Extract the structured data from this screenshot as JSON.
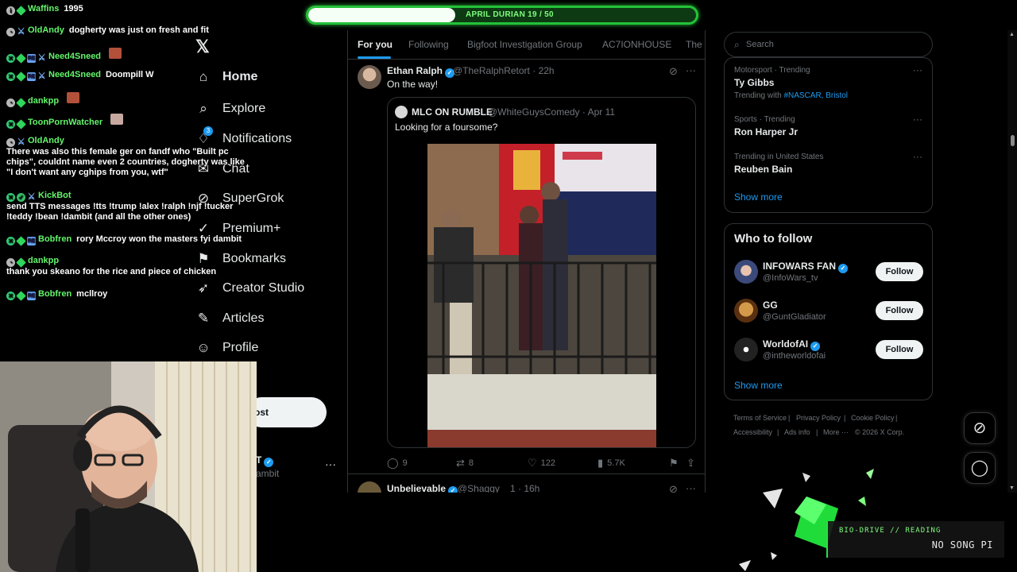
{
  "progress": {
    "label": "APRIL DURIAN 19 / 50",
    "current": 19,
    "total": 50
  },
  "chat": [
    {
      "user": "Waffins",
      "text": "1995"
    },
    {
      "user": "OldAndy",
      "text": "dogherty was just on fresh and fit"
    },
    {
      "user": "Need4Sneed",
      "text": ""
    },
    {
      "user": "Need4Sneed",
      "text": "Doompill W"
    },
    {
      "user": "dankpp",
      "text": ""
    },
    {
      "user": "ToonPornWatcher",
      "text": ""
    },
    {
      "user": "OldAndy",
      "text": "There was also this female ger on fandf who \"Built pc chips\", couldnt name even 2 countries, dogherty was like \"I don't want any cghips from you, wtf\""
    },
    {
      "user": "KickBot",
      "text": "send TTS messages !tts !trump !alex !ralph !njf !tucker !teddy !bean !dambit (and all the other ones)"
    },
    {
      "user": "Bobfren",
      "text": "rory Mccroy won the masters fyi dambit"
    },
    {
      "user": "dankpp",
      "text": "thank you skeano for the rice and piece of chicken"
    },
    {
      "user": "Bobfren",
      "text": "mcllroy"
    }
  ],
  "nav": {
    "logo": "𝕏",
    "items": [
      {
        "label": "Home",
        "icon": "home-icon",
        "glyph": "⌂"
      },
      {
        "label": "Explore",
        "icon": "search-icon",
        "glyph": "⌕"
      },
      {
        "label": "Notifications",
        "icon": "bell-icon",
        "glyph": "🔔"
      },
      {
        "label": "Chat",
        "icon": "chat-icon",
        "glyph": "✉"
      },
      {
        "label": "SuperGrok",
        "icon": "grok-icon",
        "glyph": "⊘"
      },
      {
        "label": "Premium+",
        "icon": "premium-icon",
        "glyph": "✓"
      },
      {
        "label": "Bookmarks",
        "icon": "bookmark-icon",
        "glyph": "⚑"
      },
      {
        "label": "Creator Studio",
        "icon": "rocket-icon",
        "glyph": "➶"
      },
      {
        "label": "Articles",
        "icon": "articles-icon",
        "glyph": "✎"
      },
      {
        "label": "Profile",
        "icon": "profile-icon",
        "glyph": "☺"
      }
    ],
    "notification_count": "3",
    "post_label": "ost",
    "account_name": "T",
    "account_handle": "ambit"
  },
  "timeline": {
    "tabs": [
      "For you",
      "Following",
      "Bigfoot Investigation Group",
      "AC7IONHOUSE",
      "The I"
    ],
    "tweet": {
      "name": "Ethan Ralph",
      "handle": "@TheRalphRetort",
      "time": "22h",
      "text": "On the way!",
      "quote": {
        "name": "MLC ON RUMBLE",
        "handle": "@WhiteGuysComedy",
        "date": "Apr 11",
        "text": "Looking for a foursome?"
      },
      "replies": "9",
      "reposts": "8",
      "likes": "122",
      "views": "5.7K"
    },
    "next_tweet": {
      "name": "Unbelievable",
      "handle": "@Shaggy",
      "time": "1 · 16h"
    }
  },
  "right": {
    "search_placeholder": "Search",
    "trends": [
      {
        "meta": "Motorsport · Trending",
        "title": "Ty Gibbs",
        "with_prefix": "Trending with ",
        "with_links": "#NASCAR, Bristol"
      },
      {
        "meta": "Sports · Trending",
        "title": "Ron Harper Jr"
      },
      {
        "meta": "Trending in United States",
        "title": "Reuben Bain"
      }
    ],
    "show_more": "Show more",
    "who_to_follow_title": "Who to follow",
    "follow_label": "Follow",
    "suggestions": [
      {
        "name": "INFOWARS FAN",
        "handle": "@InfoWars_tv",
        "verified": true
      },
      {
        "name": "GG",
        "handle": "@GuntGladiator",
        "verified": false
      },
      {
        "name": "WorldofAI",
        "handle": "@intheworldofai",
        "verified": true
      }
    ],
    "footer": {
      "terms": "Terms of Service",
      "privacy": "Privacy Policy",
      "cookie": "Cookie Policy",
      "accessibility": "Accessibility",
      "ads": "Ads info",
      "more": "More ···",
      "copyright": "© 2026 X Corp."
    }
  },
  "biodrive": {
    "label": "BIO-DRIVE // READING",
    "song": "NO SONG PI"
  },
  "colors": {
    "accent": "#1d9bf0",
    "chat_name": "#63f56b",
    "progress_border": "#25c13a"
  }
}
